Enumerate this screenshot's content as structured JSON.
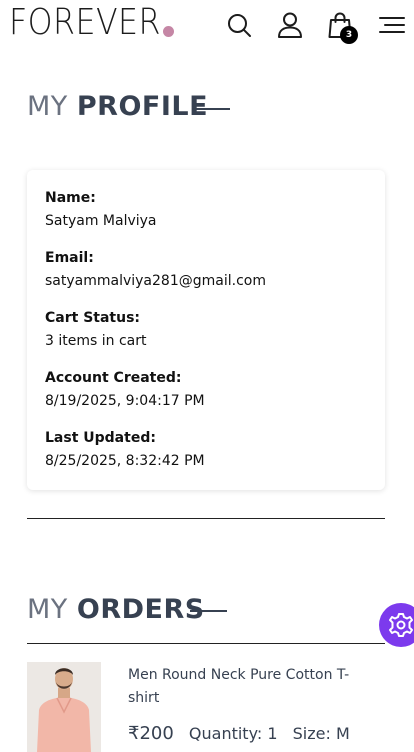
{
  "header": {
    "logo": "FOREVER",
    "cart_count": "3",
    "colors": {
      "logo_dot": "#c586a5"
    }
  },
  "profile": {
    "title_light": "MY",
    "title_bold": "PROFILE",
    "fields": [
      {
        "label": "Name:",
        "value": "Satyam Malviya"
      },
      {
        "label": "Email:",
        "value": "satyammalviya281@gmail.com"
      },
      {
        "label": "Cart Status:",
        "value": "3 items in cart"
      },
      {
        "label": "Account Created:",
        "value": "8/19/2025, 9:04:17 PM"
      },
      {
        "label": "Last Updated:",
        "value": "8/25/2025, 8:32:42 PM"
      }
    ]
  },
  "orders": {
    "title_light": "MY",
    "title_bold": "ORDERS",
    "items": [
      {
        "name": "Men Round Neck Pure Cotton T-shirt",
        "price": "₹200",
        "quantity": "Quantity: 1",
        "size": "Size: M"
      }
    ]
  },
  "floating_button": {
    "icon": "gear-icon",
    "color": "#7c3aed"
  }
}
